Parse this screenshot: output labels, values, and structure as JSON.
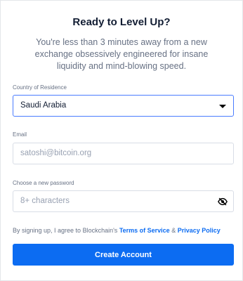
{
  "header": {
    "title": "Ready to Level Up?",
    "subtitle": "You're less than 3 minutes away from a new exchange obsessively engineered for insane liquidity and mind-blowing speed."
  },
  "country": {
    "label": "Country of Residence",
    "value": "Saudi Arabia"
  },
  "email": {
    "label": "Email",
    "placeholder": "satoshi@bitcoin.org"
  },
  "password": {
    "label": "Choose a new password",
    "placeholder": "8+ characters",
    "icon": "eye-slash-icon"
  },
  "terms": {
    "prefix": "By signing up, I agree to Blockchain's ",
    "terms_link": "Terms of Service",
    "and": " & ",
    "privacy_link": "Privacy Policy"
  },
  "submit": {
    "label": "Create Account"
  },
  "colors": {
    "accent": "#0c6cf2",
    "title": "#121d33",
    "muted": "#677184",
    "border": "#d8dde6",
    "focus_border": "#4a7cff"
  }
}
